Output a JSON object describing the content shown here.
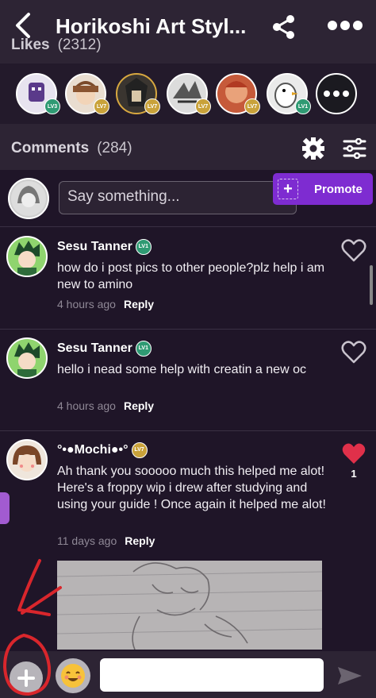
{
  "header": {
    "title": "Horikoshi Art Styl...",
    "likes_label": "Likes",
    "likes_count": "(2312)"
  },
  "likers": [
    {
      "level": "LV3",
      "badge": "green"
    },
    {
      "level": "LV7",
      "badge": "gold"
    },
    {
      "level": "LV7",
      "badge": "gold"
    },
    {
      "level": "LV7",
      "badge": "gold"
    },
    {
      "level": "LV7",
      "badge": "gold"
    },
    {
      "level": "LV1",
      "badge": "green"
    }
  ],
  "comments_section": {
    "label": "Comments",
    "count": "(284)",
    "compose_placeholder": "Say something...",
    "promote_label": "Promote"
  },
  "comments": [
    {
      "author": "Sesu Tanner",
      "level": "LV1",
      "text": "how do i post pics to other people?plz help i am new to amino",
      "time": "4 hours ago",
      "reply": "Reply",
      "likes": ""
    },
    {
      "author": "Sesu Tanner",
      "level": "LV1",
      "text": "hello i nead some help with creatin a new oc",
      "time": "4 hours ago",
      "reply": "Reply",
      "likes": ""
    },
    {
      "author": "°•●Mochi●•°",
      "level": "LV7",
      "text": "Ah thank you sooooo  much this helped me alot! Here's a froppy wip i drew after studying and using your guide ! Once again it helped me alot!",
      "time": "11 days ago",
      "reply": "Reply",
      "likes": "1"
    }
  ],
  "colors": {
    "background": "#1f1528",
    "header": "#2d2434",
    "promote": "#7e2cd1",
    "liked_heart": "#e0304a",
    "annotation": "#d9262c"
  },
  "icons": [
    "back-arrow-icon",
    "share-icon",
    "more-icon",
    "gear-icon",
    "filter-icon",
    "plus-icon",
    "heart-icon",
    "emoji-icon",
    "send-icon"
  ]
}
